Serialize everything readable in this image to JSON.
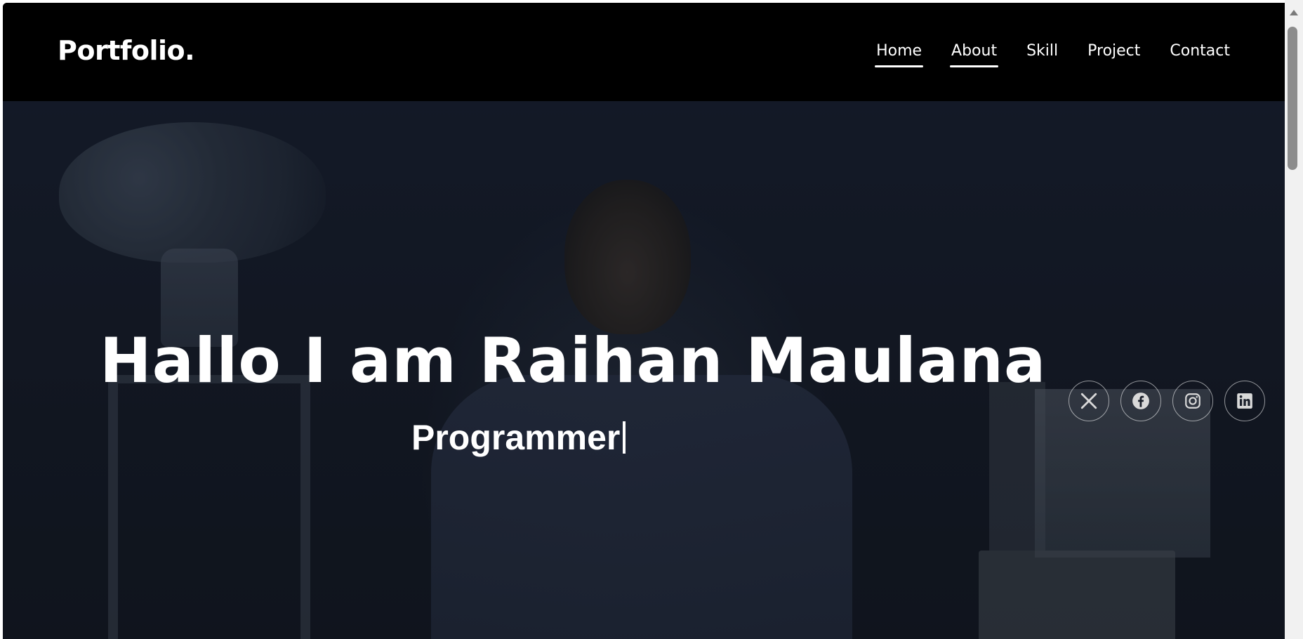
{
  "header": {
    "logo": "Portfolio."
  },
  "nav": {
    "items": [
      {
        "label": "Home",
        "underlined": true
      },
      {
        "label": "About",
        "underlined": true
      },
      {
        "label": "Skill",
        "underlined": false
      },
      {
        "label": "Project",
        "underlined": false
      },
      {
        "label": "Contact",
        "underlined": false
      }
    ]
  },
  "hero": {
    "title": "Hallo I am Raihan Maulana",
    "subtitle": "Programmer"
  },
  "socials": [
    {
      "icon": "x-twitter-icon"
    },
    {
      "icon": "facebook-icon"
    },
    {
      "icon": "instagram-icon"
    },
    {
      "icon": "linkedin-icon"
    }
  ],
  "colors": {
    "header_bg": "#000000",
    "text": "#ffffff",
    "hero_overlay": "#161b26"
  }
}
